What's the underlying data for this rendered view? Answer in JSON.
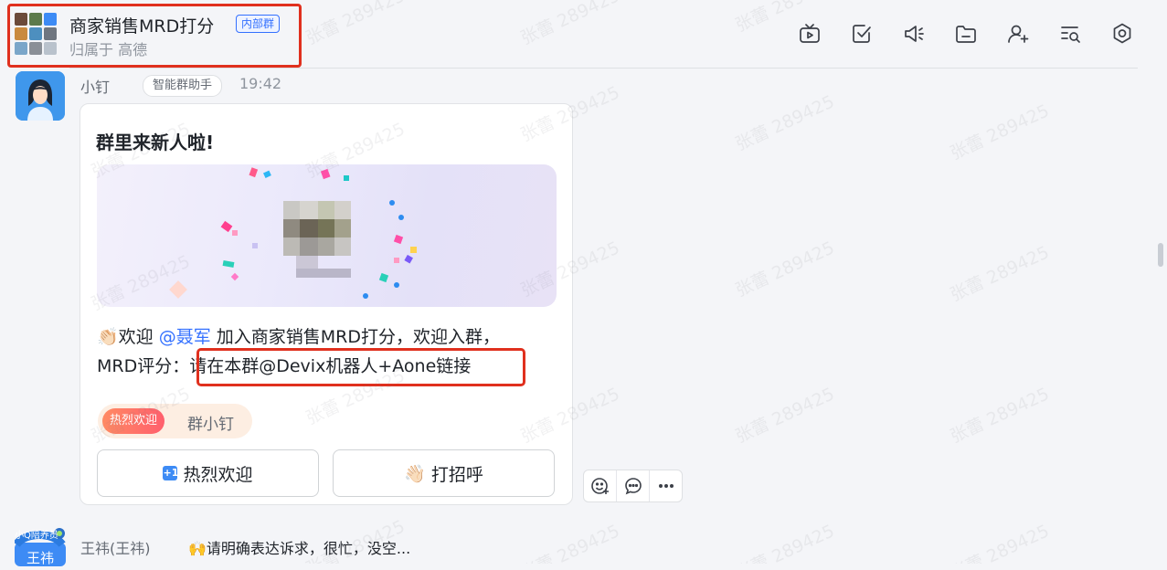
{
  "header": {
    "group_title": "商家销售MRD打分",
    "internal_tag": "内部群",
    "owner": "归属于 高德"
  },
  "toolbar": {
    "icons": [
      "video-icon",
      "task-check-icon",
      "announcement-icon",
      "folder-icon",
      "add-member-icon",
      "search-chat-icon",
      "settings-icon"
    ]
  },
  "message": {
    "sender": "小钉",
    "bot_tag": "智能群助手",
    "time": "19:42",
    "card": {
      "title": "群里来新人啦!",
      "clap_emoji": "👏🏻",
      "welcome_prefix": "欢迎 ",
      "mention": "@聂军",
      "welcome_suffix": "  加入商家销售MRD打分，欢迎入群，",
      "line2_prefix": "MRD评分：",
      "line2_highlight": "请在本群@Devix机器人+Aone链接",
      "pill_badge": "热烈欢迎",
      "pill_text": "群小钉",
      "button_welcome": "热烈欢迎",
      "button_welcome_badge": "+1",
      "button_greet_emoji": "👋🏻",
      "button_greet": "打招呼"
    }
  },
  "next_message": {
    "avatar_badge": "小Q陪养员",
    "avatar_name": "王祎",
    "sender": "王祎(王祎)",
    "emoji": "🙌",
    "text": "请明确表达诉求，很忙，没空..."
  },
  "watermark": "张蕾 289425",
  "colors": {
    "accent": "#3370ff",
    "highlight_box": "#e0301e"
  }
}
